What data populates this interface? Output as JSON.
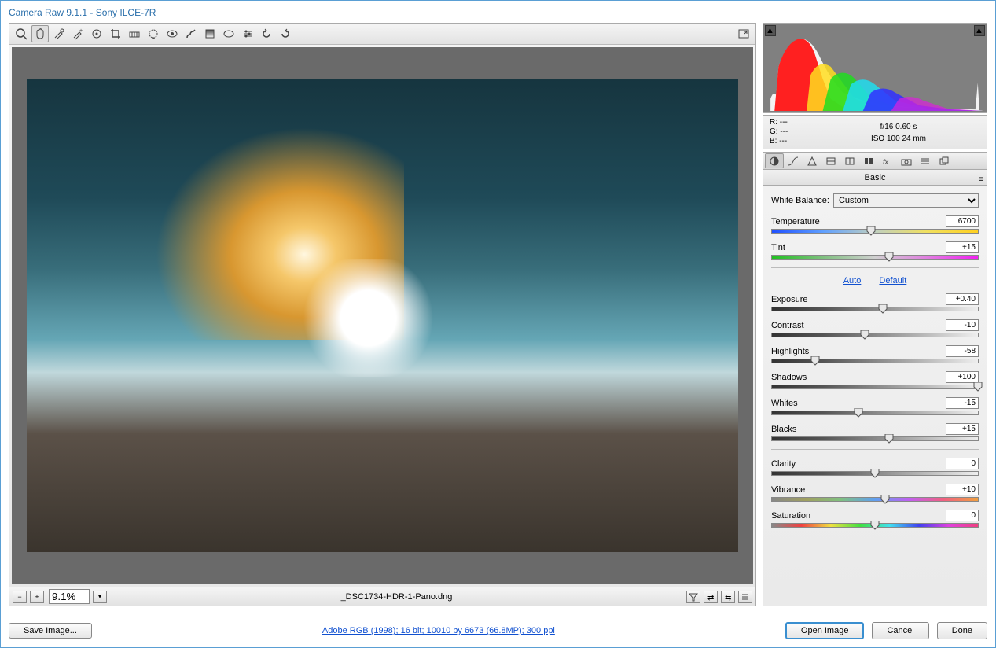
{
  "title": "Camera Raw 9.1.1   -   Sony ILCE-7R",
  "zoom": "9.1%",
  "filename": "_DSC1734-HDR-1-Pano.dng",
  "histogram_info": {
    "r": "R:    ---",
    "g": "G:    ---",
    "b": "B:    ---",
    "line1": "f/16    0.60 s",
    "line2": "ISO 100    24 mm"
  },
  "panel_title": "Basic",
  "white_balance": {
    "label": "White Balance:",
    "value": "Custom"
  },
  "sliders": {
    "temperature": {
      "label": "Temperature",
      "value": "6700",
      "pos": 48
    },
    "tint": {
      "label": "Tint",
      "value": "+15",
      "pos": 57
    },
    "exposure": {
      "label": "Exposure",
      "value": "+0.40",
      "pos": 54
    },
    "contrast": {
      "label": "Contrast",
      "value": "-10",
      "pos": 45
    },
    "highlights": {
      "label": "Highlights",
      "value": "-58",
      "pos": 21
    },
    "shadows": {
      "label": "Shadows",
      "value": "+100",
      "pos": 100
    },
    "whites": {
      "label": "Whites",
      "value": "-15",
      "pos": 42
    },
    "blacks": {
      "label": "Blacks",
      "value": "+15",
      "pos": 57
    },
    "clarity": {
      "label": "Clarity",
      "value": "0",
      "pos": 50
    },
    "vibrance": {
      "label": "Vibrance",
      "value": "+10",
      "pos": 55
    },
    "saturation": {
      "label": "Saturation",
      "value": "0",
      "pos": 50
    }
  },
  "links": {
    "auto": "Auto",
    "default": "Default"
  },
  "buttons": {
    "save_image": "Save Image...",
    "open_image": "Open Image",
    "cancel": "Cancel",
    "done": "Done"
  },
  "workflow_link": "Adobe RGB (1998); 16 bit; 10010 by 6673 (66.8MP); 300 ppi"
}
